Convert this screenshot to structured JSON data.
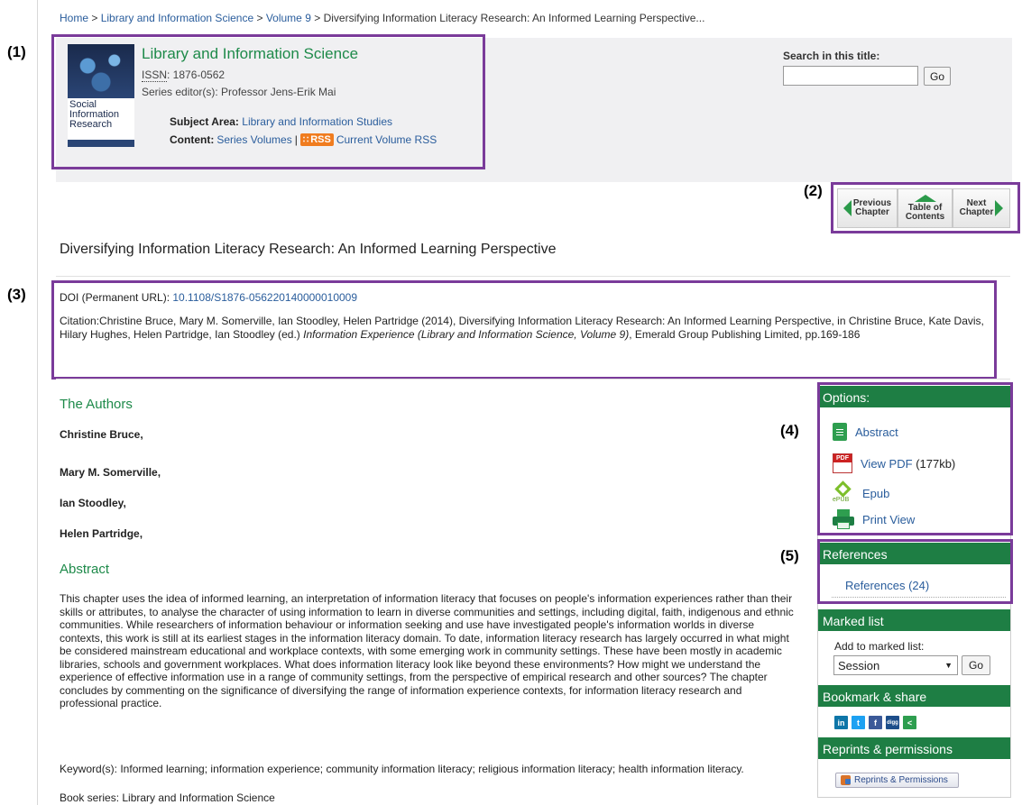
{
  "markers": {
    "m1": "(1)",
    "m2": "(2)",
    "m3": "(3)",
    "m4": "(4)",
    "m5": "(5)"
  },
  "breadcrumb": {
    "home": "Home",
    "series": "Library and Information Science",
    "volume": "Volume 9",
    "current": "Diversifying Information Literacy Research: An Informed Learning Perspective...",
    "separator": " > "
  },
  "series_info": {
    "cover_text": "Social Information Research",
    "title": "Library and Information Science",
    "issn_abbr": "ISSN",
    "issn_value": ": 1876-0562",
    "editor": "Series editor(s): Professor Jens-Erik Mai",
    "subject_label": "Subject Area:",
    "subject_value": "Library and Information Studies",
    "content_label": "Content:",
    "series_volumes": "Series Volumes",
    "pipe": "|",
    "rss_badge": "RSS",
    "current_volume_rss": "Current Volume RSS"
  },
  "search": {
    "label": "Search in this title:",
    "value": "",
    "go": "Go"
  },
  "chapter_nav": {
    "prev_line1": "Previous",
    "prev_line2": "Chapter",
    "toc_line1": "Table of",
    "toc_line2": "Contents",
    "next_line1": "Next",
    "next_line2": "Chapter"
  },
  "chapter": {
    "title": "Diversifying Information Literacy Research: An Informed Learning Perspective",
    "doi_label": "DOI (Permanent URL): ",
    "doi_value": "10.1108/S1876-056220140000010009",
    "citation_part1": "Citation:Christine Bruce, Mary M. Somerville, Ian Stoodley, Helen Partridge (2014), Diversifying Information Literacy Research: An Informed Learning Perspective, in Christine Bruce, Kate Davis, Hilary Hughes, Helen Partridge, Ian Stoodley (ed.) ",
    "citation_italic": "Information Experience (Library and Information Science, Volume 9)",
    "citation_part2": ", Emerald Group Publishing Limited, pp.169-186"
  },
  "authors": {
    "heading": "The Authors",
    "list": [
      "Christine Bruce,",
      "Mary M. Somerville,",
      "Ian Stoodley,",
      "Helen Partridge,"
    ]
  },
  "abstract": {
    "heading": "Abstract",
    "text": "This chapter uses the idea of informed learning, an interpretation of information literacy that focuses on people's information experiences rather than their skills or attributes, to analyse the character of using information to learn in diverse communities and settings, including digital, faith, indigenous and ethnic communities. While researchers of information behaviour or information seeking and use have investigated people's information worlds in diverse contexts, this work is still at its earliest stages in the information literacy domain. To date, information literacy research has largely occurred in what might be considered mainstream educational and workplace contexts, with some emerging work in community settings. These have been mostly in academic libraries, schools and government workplaces. What does information literacy look like beyond these environments? How might we understand the experience of effective information use in a range of community settings, from the perspective of empirical research and other sources? The chapter concludes by commenting on the significance of diversifying the range of information experience contexts, for information literacy research and professional practice.",
    "keywords": "Keyword(s):  Informed learning; information experience; community information literacy; religious information literacy; health information literacy.",
    "book_series": "Book series:  Library and Information Science"
  },
  "sidebar": {
    "options_head": "Options:",
    "abstract": "Abstract",
    "view_pdf": "View PDF",
    "pdf_size": "(177kb)",
    "epub": "Epub",
    "epub_icon_label": "ePUB",
    "print_view": "Print View",
    "references_head": "References",
    "references_link": "References (24)",
    "marked_head": "Marked list",
    "marked_label": "Add to marked list:",
    "marked_selected": "Session",
    "marked_go": "Go",
    "bookmark_head": "Bookmark & share",
    "share_icons": [
      {
        "name": "linkedin-icon",
        "glyph": "in",
        "color": "#0e76a8"
      },
      {
        "name": "twitter-icon",
        "glyph": "t",
        "color": "#1da1f2"
      },
      {
        "name": "facebook-icon",
        "glyph": "f",
        "color": "#3b5998"
      },
      {
        "name": "digg-icon",
        "glyph": "digg",
        "color": "#1d4e8a"
      },
      {
        "name": "share-icon",
        "glyph": "<",
        "color": "#2e9e4f"
      }
    ],
    "reprints_head": "Reprints & permissions",
    "reprints_button": "Reprints & Permissions"
  },
  "colors": {
    "accent_green": "#1e7e44",
    "annotation_purple": "#7a3b9a"
  }
}
